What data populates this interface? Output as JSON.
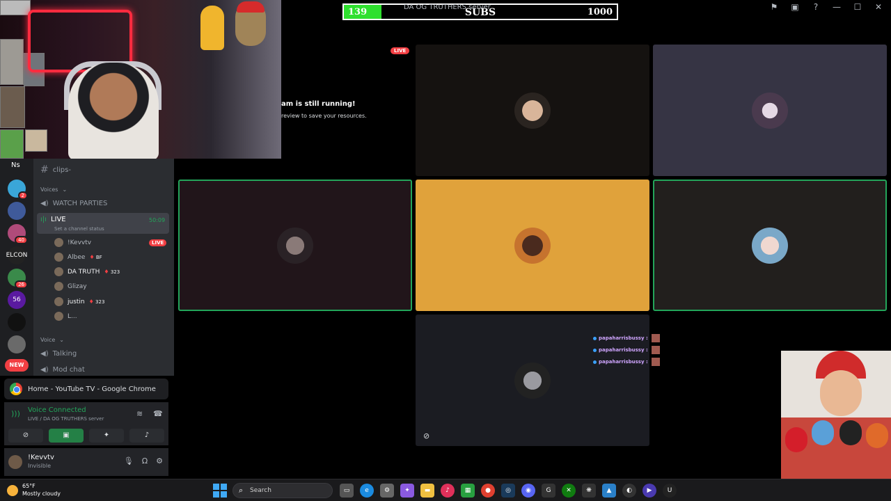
{
  "subs_goal": {
    "current": "139",
    "label": "SUBS",
    "goal": "1000",
    "progress": 0.139
  },
  "server_title": "DA OG TRUTHERS server",
  "server_rail": {
    "top_label": "Ns",
    "servers": [
      {
        "name": "server-1",
        "badge": "2",
        "color": "#3aa6d8"
      },
      {
        "name": "server-2",
        "badge": "",
        "color": "#3f5a9a"
      },
      {
        "name": "server-3",
        "badge": "40",
        "color": "#b04b7a"
      },
      {
        "name": "server-4",
        "badge": "",
        "color": "#222",
        "text": "ELCON"
      },
      {
        "name": "server-5",
        "badge": "26",
        "color": "#3a8a4a"
      },
      {
        "name": "server-6",
        "badge": "",
        "color": "#5a1aa0",
        "text": "56"
      },
      {
        "name": "server-7",
        "badge": "",
        "color": "#111"
      },
      {
        "name": "server-8",
        "badge": "",
        "color": "#6a6a6a"
      }
    ],
    "new_label": "NEW"
  },
  "channels": {
    "clips": "clips-",
    "voices_header": "Voices",
    "watch_parties": "WATCH PARTIES",
    "live_channel": "LIVE",
    "live_timer": "50:09",
    "set_status": "Set a channel status",
    "users": [
      {
        "name": "!Kevvtv",
        "extra": "",
        "live": "LIVE"
      },
      {
        "name": "Albee",
        "extra": "BF",
        "live": ""
      },
      {
        "name": "DA TRUTH",
        "extra": "323",
        "live": ""
      },
      {
        "name": "Glizay",
        "extra": "",
        "live": ""
      },
      {
        "name": "justin",
        "extra": "323",
        "live": ""
      },
      {
        "name": "L...",
        "extra": "",
        "live": ""
      }
    ],
    "voice_header": "Voice",
    "talking": "Talking",
    "mod_chat": "Mod chat"
  },
  "chrome_card": {
    "title": "Home - YouTube TV - Google Chrome"
  },
  "voice_panel": {
    "status": "Voice Connected",
    "location": "LIVE / DA OG TRUTHERS server"
  },
  "user_panel": {
    "name": "!Kevvtv",
    "status": "Invisible"
  },
  "stage": {
    "live_badge": "LIVE",
    "notice_title": "am is still running!",
    "notice_sub": "review to save your resources."
  },
  "chat": {
    "lines": [
      "papaharrisbussy :",
      "papaharrisbussy :",
      "papaharrisbussy :"
    ]
  },
  "taskbar": {
    "weather_temp": "65°F",
    "weather_cond": "Mostly cloudy",
    "search_placeholder": "Search"
  },
  "colors": {
    "accent_green": "#23a55a",
    "live_red": "#f23f43",
    "tile_yellow": "#e0a23b"
  }
}
